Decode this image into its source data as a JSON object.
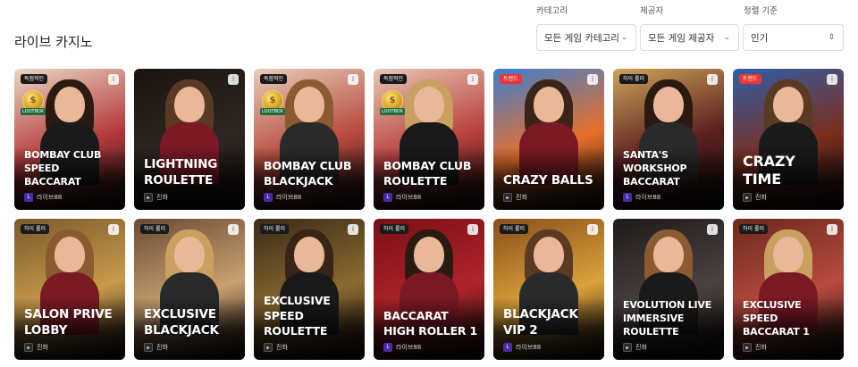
{
  "page": {
    "title": "라이브 카지노"
  },
  "filters": {
    "category": {
      "label": "카테고리",
      "value": "모든 게임 카테고리",
      "icon": "chevron-down-icon"
    },
    "provider": {
      "label": "제공자",
      "value": "모든 게임 제공자",
      "icon": "chevron-down-icon"
    },
    "sort": {
      "label": "정렬 기준",
      "value": "인기",
      "icon": "sort-arrows-icon"
    }
  },
  "games": [
    {
      "title": "BOMBAY CLUB SPEED BACCARAT",
      "provider": "라이브88",
      "provider_icon": "live88-logo-icon",
      "badge": "독점적인",
      "lootbox": "LOOTBOX",
      "colors": [
        "#b43a3a",
        "#e8d8c5"
      ]
    },
    {
      "title": "LIGHTNING ROULETTE",
      "provider": "진화",
      "provider_icon": "evolution-logo-icon",
      "badge": "",
      "lootbox": "",
      "colors": [
        "#2d2622",
        "#1b1512"
      ]
    },
    {
      "title": "BOMBAY CLUB BLACKJACK",
      "provider": "라이브88",
      "provider_icon": "live88-logo-icon",
      "badge": "독점적인",
      "lootbox": "LOOTBOX",
      "colors": [
        "#b84a3e",
        "#e8cdb9"
      ]
    },
    {
      "title": "BOMBAY CLUB ROULETTE",
      "provider": "라이브88",
      "provider_icon": "live88-logo-icon",
      "badge": "독점적인",
      "lootbox": "LOOTBOX",
      "colors": [
        "#b7403d",
        "#e9c7b4"
      ]
    },
    {
      "title": "CRAZY BALLS",
      "provider": "진화",
      "provider_icon": "evolution-logo-icon",
      "badge": "트렌드",
      "lootbox": "",
      "colors": [
        "#e76f2a",
        "#3e7fd0"
      ]
    },
    {
      "title": "SANTA'S WORKSHOP BACCARAT",
      "provider": "라이브88",
      "provider_icon": "live88-logo-icon",
      "badge": "하이 롤러",
      "lootbox": "",
      "colors": [
        "#5a1f1f",
        "#cfa35a"
      ]
    },
    {
      "title": "CRAZY TIME",
      "provider": "진화",
      "provider_icon": "evolution-logo-icon",
      "badge": "트렌드",
      "lootbox": "",
      "colors": [
        "#7a2e1e",
        "#2f5fa8"
      ]
    },
    {
      "title": "SALON PRIVE LOBBY",
      "provider": "진화",
      "provider_icon": "evolution-logo-icon",
      "badge": "하이 롤러",
      "lootbox": "",
      "colors": [
        "#c89a4a",
        "#7a5a2c"
      ]
    },
    {
      "title": "EXCLUSIVE BLACKJACK",
      "provider": "진화",
      "provider_icon": "evolution-logo-icon",
      "badge": "하이 롤러",
      "lootbox": "",
      "colors": [
        "#c9a070",
        "#6a4a34"
      ]
    },
    {
      "title": "EXCLUSIVE SPEED ROULETTE",
      "provider": "진화",
      "provider_icon": "evolution-logo-icon",
      "badge": "하이 롤러",
      "lootbox": "",
      "colors": [
        "#8a6a30",
        "#3a2a18"
      ]
    },
    {
      "title": "BACCARAT HIGH ROLLER 1",
      "provider": "라이브88",
      "provider_icon": "live88-logo-icon",
      "badge": "하이 롤러",
      "lootbox": "",
      "colors": [
        "#b0232a",
        "#7a0f16"
      ]
    },
    {
      "title": "BLACKJACK VIP 2",
      "provider": "라이브88",
      "provider_icon": "live88-logo-icon",
      "badge": "하이 롤러",
      "lootbox": "",
      "colors": [
        "#d9a23a",
        "#8a4e1a"
      ]
    },
    {
      "title": "EVOLUTION LIVE IMMERSIVE ROULETTE",
      "provider": "진화",
      "provider_icon": "evolution-logo-icon",
      "badge": "",
      "lootbox": "",
      "colors": [
        "#4a4240",
        "#1e1a18"
      ]
    },
    {
      "title": "EXCLUSIVE SPEED BACCARAT 1",
      "provider": "진화",
      "provider_icon": "evolution-logo-icon",
      "badge": "하이 롤러",
      "lootbox": "",
      "colors": [
        "#b84a3e",
        "#6a2a1c"
      ]
    }
  ]
}
